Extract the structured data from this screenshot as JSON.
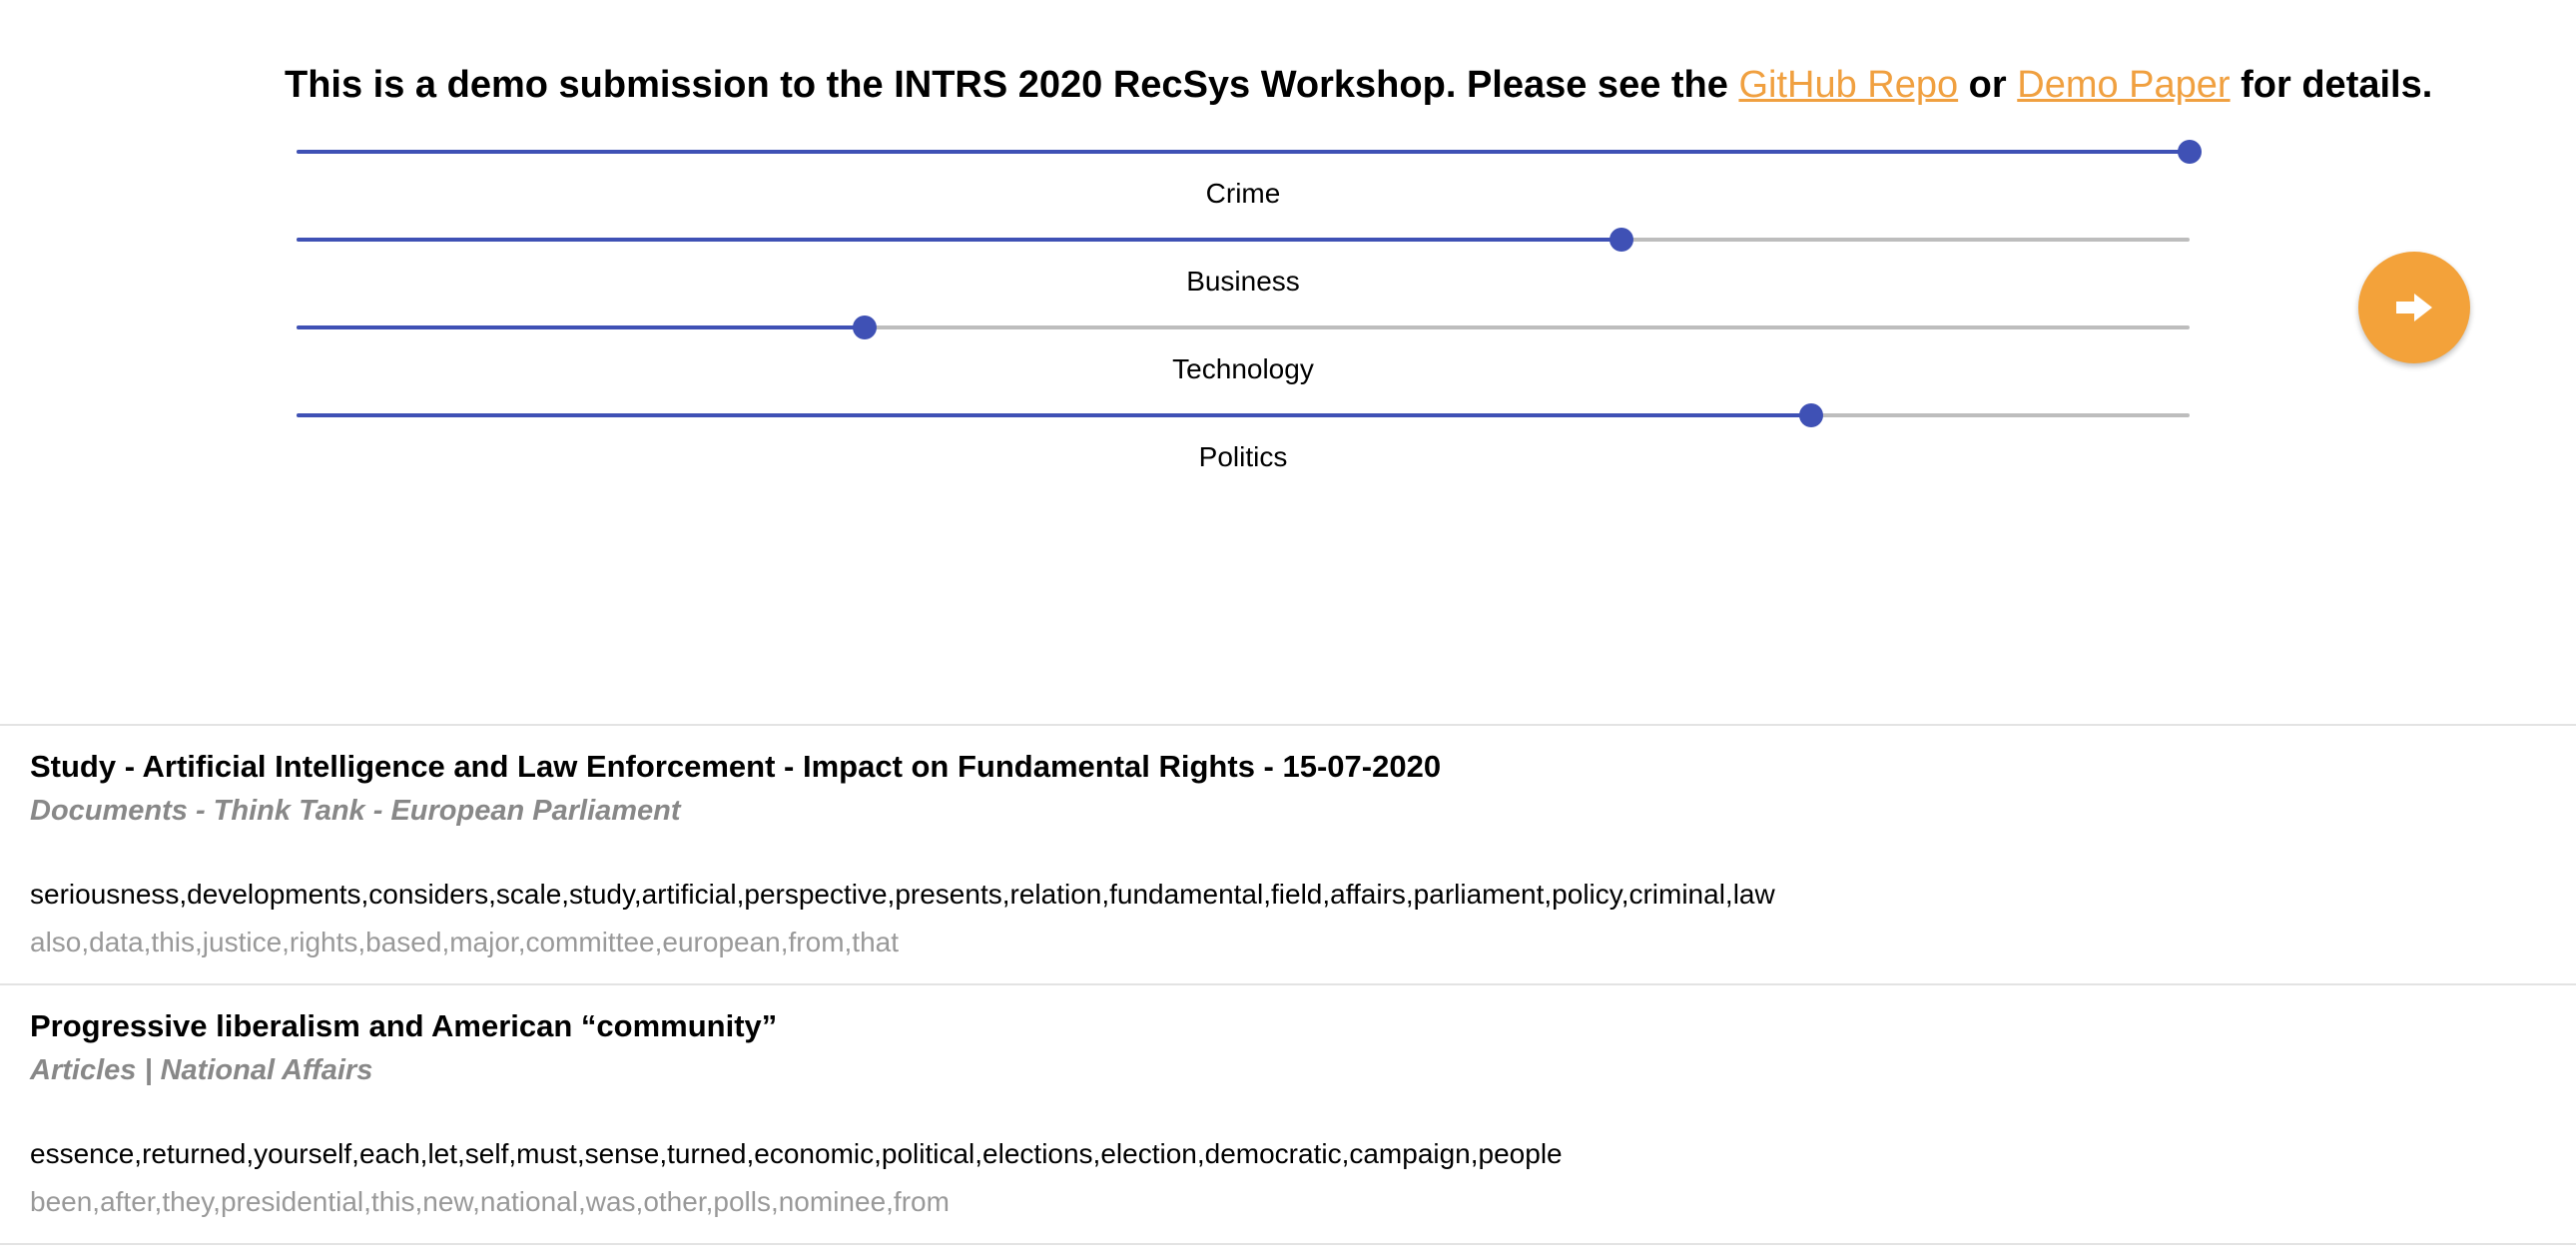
{
  "banner": {
    "text_before": "This is a demo submission to the INTRS 2020 RecSys Workshop. Please see the ",
    "github_link": "GitHub Repo",
    "text_middle": " or ",
    "paper_link": "Demo Paper",
    "text_after": " for details."
  },
  "sliders": [
    {
      "label": "Crime",
      "value_fraction": 1.0
    },
    {
      "label": "Business",
      "value_fraction": 0.7
    },
    {
      "label": "Technology",
      "value_fraction": 0.3
    },
    {
      "label": "Politics",
      "value_fraction": 0.8
    }
  ],
  "next_button": {
    "icon": "arrow-right-icon",
    "color": "#f3a23a"
  },
  "accent_color": "#3f51b5",
  "articles": [
    {
      "title": "Study - Artificial Intelligence and Law Enforcement - Impact on Fundamental Rights - 15-07-2020",
      "source": "Documents - Think Tank - European Parliament",
      "keywords": "seriousness,developments,considers,scale,study,artificial,perspective,presents,relation,fundamental,field,affairs,parliament,policy,criminal,law",
      "keywords_secondary": "also,data,this,justice,rights,based,major,committee,european,from,that"
    },
    {
      "title": "Progressive liberalism and American “community”",
      "source": "Articles | National Affairs",
      "keywords": "essence,returned,yourself,each,let,self,must,sense,turned,economic,political,elections,election,democratic,campaign,people",
      "keywords_secondary": "been,after,they,presidential,this,new,national,was,other,polls,nominee,from"
    }
  ]
}
